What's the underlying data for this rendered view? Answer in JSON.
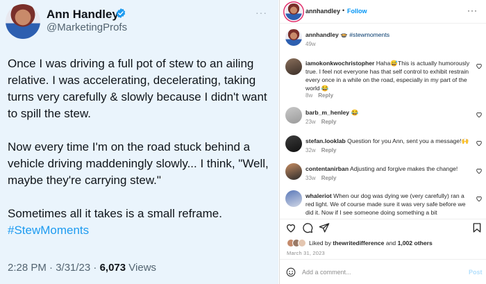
{
  "tweet": {
    "name": "Ann Handley",
    "handle": "@MarketingProfs",
    "more": "···",
    "paragraphs": [
      "Once I was driving a full pot of stew to an ailing relative. I was accelerating, decelerating, taking turns very carefully & slowly because I didn't want to spill the stew.",
      "Now every time I'm on the road stuck behind a vehicle driving maddeningly slowly... I think, \"Well, maybe they're carrying stew.\"",
      "Sometimes all it takes is a small reframe."
    ],
    "hashtag": "#StewMoments",
    "time": "2:28 PM · 3/31/23 · ",
    "views_count": "6,073",
    "views_label": " Views",
    "icons": {
      "verified": "verified-badge-icon",
      "more": "more-options-icon"
    },
    "colors": {
      "background": "#eaf4fc",
      "link": "#1d9bf0",
      "verified": "#1d9bf0"
    }
  },
  "instagram": {
    "header": {
      "username": "annhandley",
      "dot": "•",
      "follow": "Follow",
      "more": "···"
    },
    "caption": {
      "username": "annhandley",
      "emoji": "🍲",
      "hashtag": "#stewmoments",
      "time": "49w"
    },
    "comments": [
      {
        "username": "iamokonkwochristopher",
        "text": "Haha😅This is actually humorously true. I feel not everyone has that self control to exhibit restrain every once in a while on the road, especially in my part of the world 😂",
        "time": "8w",
        "reply": "Reply"
      },
      {
        "username": "barb_m_henley",
        "text": "😂",
        "time": "23w",
        "reply": "Reply"
      },
      {
        "username": "stefan.looklab",
        "text": "Question for you Ann, sent you a message!🙌",
        "time": "32w",
        "reply": "Reply"
      },
      {
        "username": "contentanirban",
        "text": "Adjusting and forgive makes the change!",
        "time": "33w",
        "reply": "Reply"
      },
      {
        "username": "whaleriot",
        "text": "When our dog was dying we (very carefully) ran a red light. We of course made sure it was very safe before we did it. Now if I see someone doing something a bit",
        "time": "",
        "reply": ""
      }
    ],
    "likes": {
      "prefix": "Liked by ",
      "user": "thewritedifference",
      "and": " and ",
      "others": "1,002 others"
    },
    "date": "March 31, 2023",
    "add_comment": {
      "placeholder": "Add a comment...",
      "post": "Post"
    },
    "icons": {
      "like": "heart-icon",
      "comment": "comment-icon",
      "share": "share-icon",
      "save": "bookmark-icon",
      "emoji": "emoji-icon",
      "comment_like": "heart-icon"
    },
    "colors": {
      "link": "#0095f6",
      "text": "#262626",
      "muted": "#8e8e8e",
      "post_disabled": "#b2dffc"
    }
  }
}
